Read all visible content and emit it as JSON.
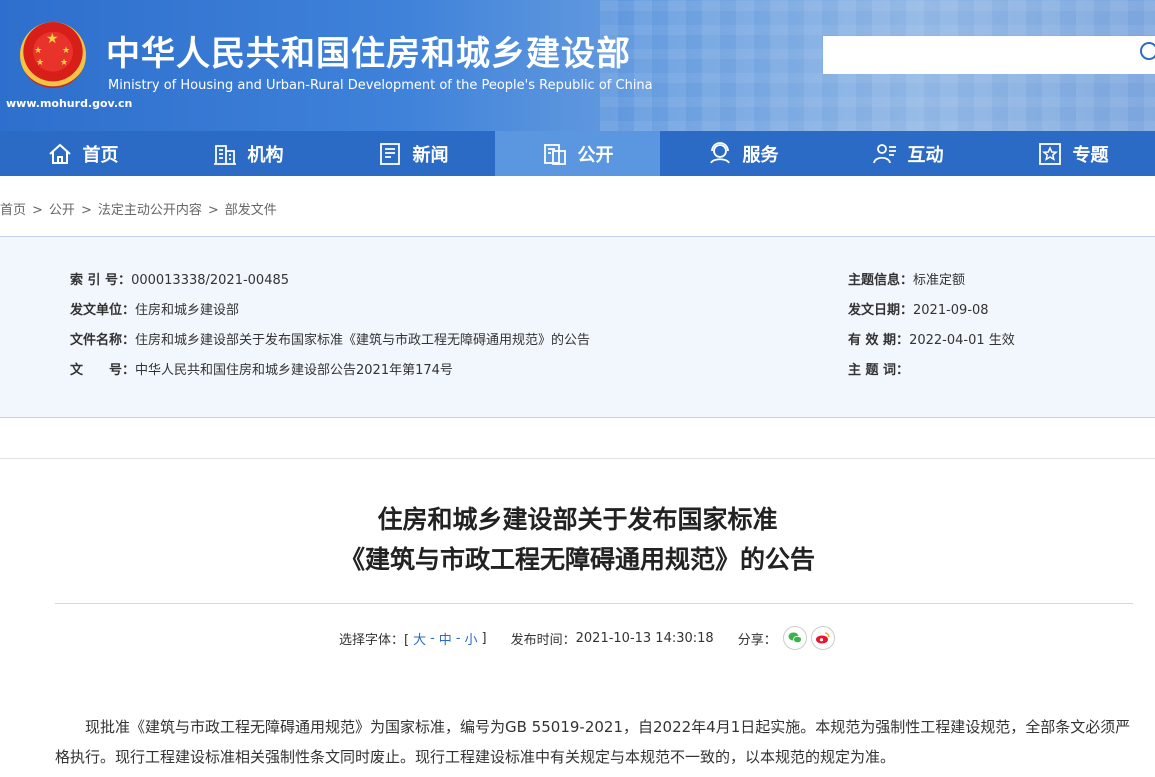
{
  "header": {
    "title": "中华人民共和国住房和城乡建设部",
    "subtitle": "Ministry of Housing and Urban-Rural Development of the People's Republic of China",
    "url": "www.mohurd.gov.cn",
    "search_placeholder": ""
  },
  "nav": [
    {
      "label": "首页",
      "icon": "home-icon"
    },
    {
      "label": "机构",
      "icon": "building-icon"
    },
    {
      "label": "新闻",
      "icon": "news-icon"
    },
    {
      "label": "公开",
      "icon": "document-icon",
      "active": true
    },
    {
      "label": "服务",
      "icon": "service-icon"
    },
    {
      "label": "互动",
      "icon": "interact-icon"
    },
    {
      "label": "专题",
      "icon": "star-icon"
    }
  ],
  "breadcrumb": [
    "首页",
    "公开",
    "法定主动公开内容",
    "部发文件"
  ],
  "info": {
    "index_label": "索 引 号：",
    "index_value": "000013338/2021-00485",
    "issuer_label": "发文单位：",
    "issuer_value": "住房和城乡建设部",
    "docname_label": "文件名称：",
    "docname_value": "住房和城乡建设部关于发布国家标准《建筑与市政工程无障碍通用规范》的公告",
    "docno_label": "文　　号：",
    "docno_value": "中华人民共和国住房和城乡建设部公告2021年第174号",
    "topic_label": "主题信息：",
    "topic_value": "标准定额",
    "date_label": "发文日期：",
    "date_value": "2021-09-08",
    "validity_label": "有 效 期：",
    "validity_value": "2022-04-01 生效",
    "keywords_label": "主 题 词：",
    "keywords_value": ""
  },
  "article": {
    "title_line1": "住房和城乡建设部关于发布国家标准",
    "title_line2": "《建筑与市政工程无障碍通用规范》的公告",
    "font_label": "选择字体：[",
    "size_large": "大",
    "size_medium": "中",
    "size_small": "小",
    "font_close": "]",
    "publish_label": "发布时间：",
    "publish_time": "2021-10-13 14:30:18",
    "share_label": "分享：",
    "body": "现批准《建筑与市政工程无障碍通用规范》为国家标准，编号为GB 55019-2021，自2022年4月1日起实施。本规范为强制性工程建设规范，全部条文必须严格执行。现行工程建设标准相关强制性条文同时废止。现行工程建设标准中有关规定与本规范不一致的，以本规范的规定为准。"
  },
  "colors": {
    "nav": "#2b6ac5",
    "nav_active": "#5b97e0",
    "wechat": "#3bb34a",
    "weibo": "#e6162d"
  }
}
